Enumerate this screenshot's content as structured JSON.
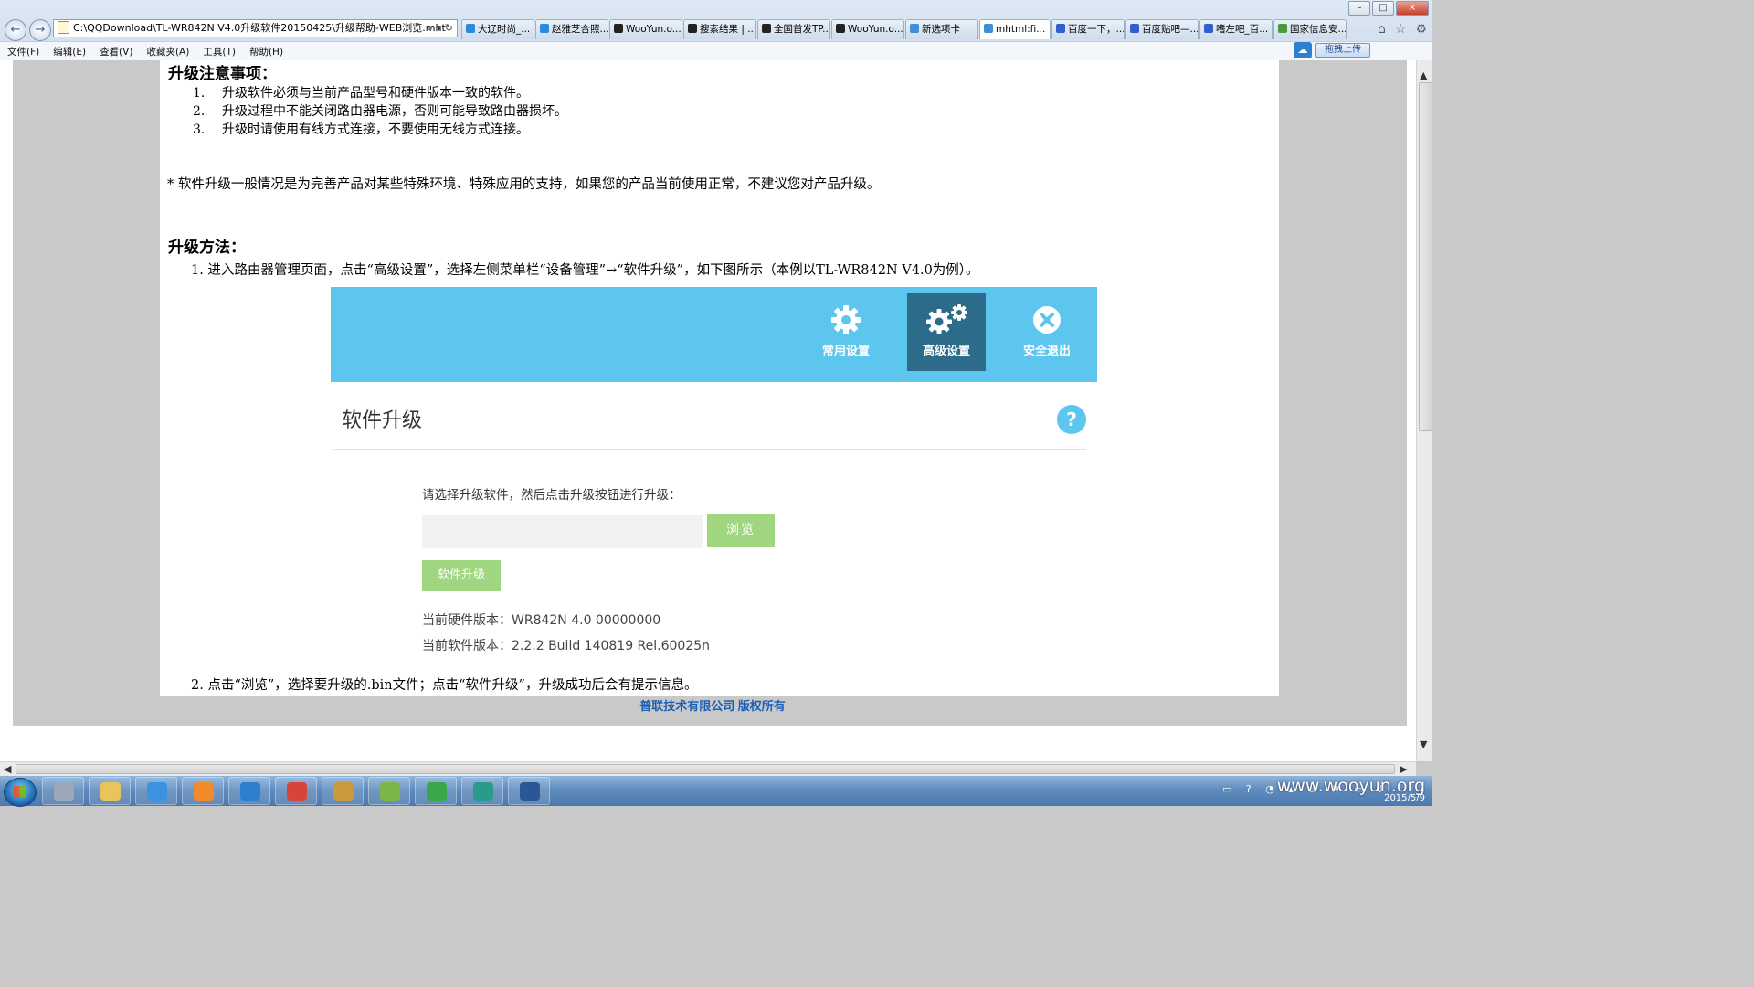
{
  "browser": {
    "address": "C:\\QQDownload\\TL-WR842N V4.0升级软件20150425\\升级帮助-WEB浏览.mht",
    "address_tools": "⌕ ▾ ↻",
    "tabs": [
      {
        "label": "大辽时尚_...",
        "color": "#2a8be0"
      },
      {
        "label": "赵雅芝合照...",
        "color": "#2a8be0"
      },
      {
        "label": "WooYun.o...",
        "color": "#222222"
      },
      {
        "label": "搜索结果 | ...",
        "color": "#222222"
      },
      {
        "label": "全国首发TP...",
        "color": "#222222"
      },
      {
        "label": "WooYun.o...",
        "color": "#222222"
      },
      {
        "label": "新选项卡",
        "color": "#3c8fd8"
      },
      {
        "label": "mhtml:fi...",
        "color": "#3c8fd8",
        "active": true,
        "close": "×"
      },
      {
        "label": "百度一下，...",
        "color": "#2f5fd0"
      },
      {
        "label": "百度贴吧—...",
        "color": "#2f5fd0"
      },
      {
        "label": "嗜左吧_百...",
        "color": "#2f5fd0"
      },
      {
        "label": "国家信息安...",
        "color": "#4a9a3a"
      }
    ],
    "menu": [
      "文件(F)",
      "编辑(E)",
      "查看(V)",
      "收藏夹(A)",
      "工具(T)",
      "帮助(H)"
    ],
    "upload_label": "拖拽上传",
    "window_buttons": [
      "–",
      "□",
      "×"
    ]
  },
  "page": {
    "notes_heading": "升级注意事项：",
    "notes": [
      {
        "num": "1.",
        "text": "升级软件必须与当前产品型号和硬件版本一致的软件。"
      },
      {
        "num": "2.",
        "text": "升级过程中不能关闭路由器电源，否则可能导致路由器损坏。"
      },
      {
        "num": "3.",
        "text": "升级时请使用有线方式连接，不要使用无线方式连接。"
      }
    ],
    "note_star": "* 软件升级一般情况是为完善产品对某些特殊环境、特殊应用的支持，如果您的产品当前使用正常，不建议您对产品升级。",
    "method_heading": "升级方法：",
    "step1": "1.  进入路由器管理页面，点击“高级设置”，选择左侧菜单栏“设备管理”→“软件升级”，如下图所示（本例以TL-WR842N V4.0为例）。",
    "step2": "2. 点击“浏览”，选择要升级的.bin文件；点击“软件升级”，升级成功后会有提示信息。",
    "footer": "普联技术有限公司 版权所有"
  },
  "router": {
    "nav": [
      {
        "label": "常用设置",
        "icon": "gear-icon",
        "active": false
      },
      {
        "label": "高级设置",
        "icon": "gears-icon",
        "active": true
      },
      {
        "label": "安全退出",
        "icon": "exit-icon",
        "active": false
      }
    ],
    "title": "软件升级",
    "help": "?",
    "prompt": "请选择升级软件，然后点击升级按钮进行升级：",
    "browse": "浏览",
    "upgrade": "软件升级",
    "hw_version": "当前硬件版本：WR842N 4.0 00000000",
    "sw_version": "当前软件版本：2.2.2 Build 140819 Rel.60025n",
    "colors": {
      "header": "#5cc6ee",
      "active_nav": "#2d6b8a",
      "button": "#9fd67f"
    }
  },
  "taskbar": {
    "watermark": "www.wooyun.org",
    "date": "2015/5/9",
    "apps": [
      {
        "name": "k-app-icon",
        "color": "#9aa8b8"
      },
      {
        "name": "explorer-icon",
        "color": "#e8c45a"
      },
      {
        "name": "ie-icon",
        "color": "#3a92e0"
      },
      {
        "name": "media-player-icon",
        "color": "#f08a2a"
      },
      {
        "name": "cloud-icon",
        "color": "#2f7fd1"
      },
      {
        "name": "chrome-icon",
        "color": "#d9443a"
      },
      {
        "name": "game-icon",
        "color": "#c89a3a"
      },
      {
        "name": "color-icon",
        "color": "#7ab648"
      },
      {
        "name": "green-app-icon",
        "color": "#3aa84a"
      },
      {
        "name": "globe-icon",
        "color": "#2a9a8a"
      },
      {
        "name": "word-icon",
        "color": "#2b5797"
      }
    ]
  }
}
